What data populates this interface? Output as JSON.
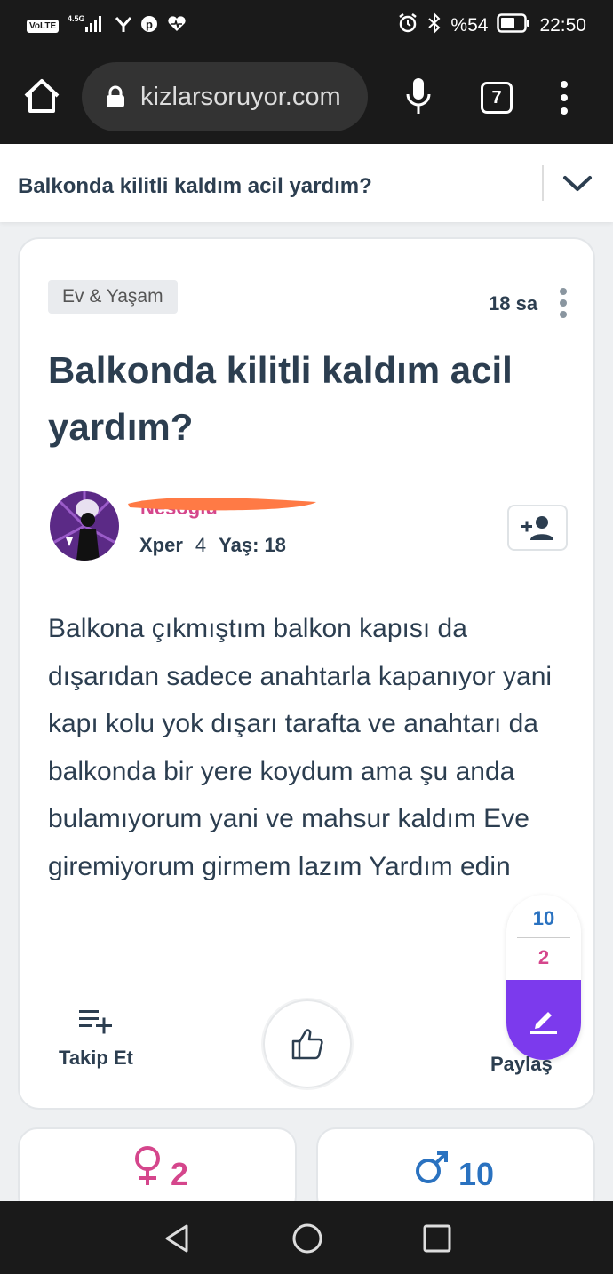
{
  "status_bar": {
    "network_badge": "VoLTE",
    "signal_label": "4.5G",
    "battery": "%54",
    "time": "22:50"
  },
  "browser": {
    "url": "kizlarsoruyor.com",
    "tab_count": "7"
  },
  "question_header": {
    "title": "Balkonda kilitli kaldım acil yardım?"
  },
  "question": {
    "category": "Ev & Yaşam",
    "time_ago": "18 sa",
    "title": "Balkonda kilitli kaldım acil yardım?",
    "author": {
      "username": "Nesoglu",
      "level_label": "Xper",
      "level": "4",
      "age_label": "Yaş:",
      "age": "18"
    },
    "body": "Balkona çıkmıştım balkon kapısı da dışarıdan sadece anahtarla kapanıyor yani kapı kolu yok dışarı tarafta ve anahtarı da balkonda bir yere koydum ama şu anda bulamıyorum yani ve mahsur kaldım Eve giremiyorum girmem lazım Yardım edin",
    "votes": {
      "male": "10",
      "female": "2"
    },
    "actions": {
      "follow_label": "Takip Et",
      "share_label": "Paylaş"
    }
  },
  "stats": {
    "female_count": "2",
    "male_count": "10"
  },
  "colors": {
    "dark": "#2c3e50",
    "pink": "#d5468c",
    "blue": "#2a72c0",
    "purple": "#7c3aed",
    "bar": "#1a1a1a"
  }
}
